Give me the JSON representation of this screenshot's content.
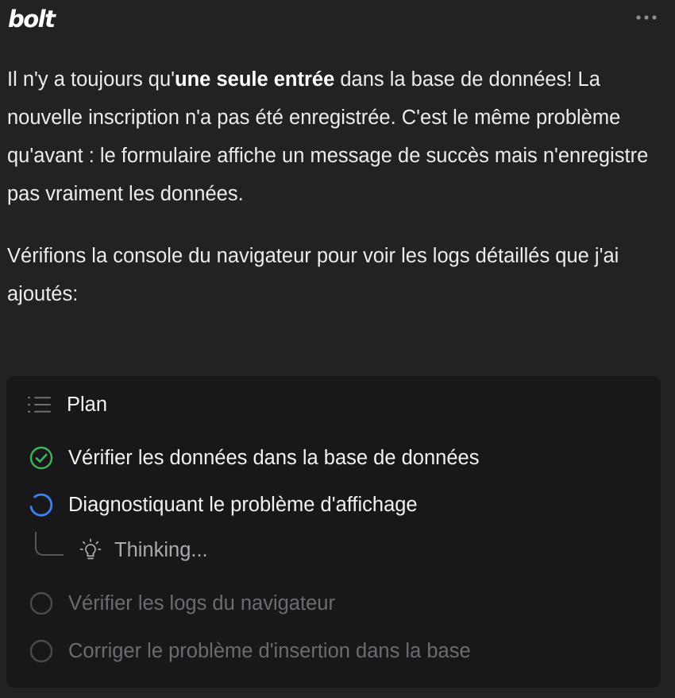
{
  "header": {
    "logo_text": "bolt",
    "more_icon": "ellipsis-icon"
  },
  "message": {
    "p1_before": "Il n'y a toujours qu'",
    "p1_bold": "une seule entrée",
    "p1_after": " dans la base de données! La nouvelle inscription n'a pas été enregistrée. C'est le même problème qu'avant : le formulaire affiche un message de succès mais n'enregistre pas vraiment les données.",
    "p2": "Vérifions la console du navigateur pour voir les logs détaillés que j'ai ajoutés:"
  },
  "plan": {
    "title": "Plan",
    "icon": "list-icon",
    "tasks": [
      {
        "label": "Vérifier les données dans la base de données",
        "status": "done",
        "icon": "check-circle-icon"
      },
      {
        "label": "Diagnostiquant le problème d'affichage",
        "status": "in-progress",
        "icon": "spinner-icon"
      },
      {
        "label": "Vérifier les logs du navigateur",
        "status": "pending",
        "icon": "empty-circle-icon"
      },
      {
        "label": "Corriger le problème d'insertion dans la base",
        "status": "pending",
        "icon": "empty-circle-icon"
      }
    ],
    "thinking": {
      "label": "Thinking...",
      "icon": "lightbulb-icon"
    }
  },
  "colors": {
    "background": "#222225",
    "card": "#18181a",
    "success": "#3fb55a",
    "progress": "#3b82f6",
    "muted_text": "#6b6b72"
  }
}
